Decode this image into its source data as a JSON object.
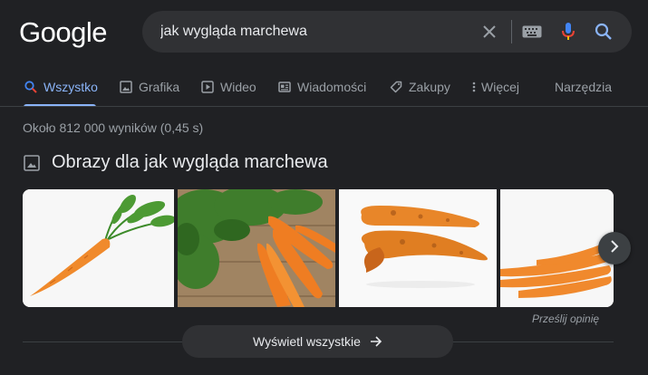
{
  "logo": "Google",
  "search": {
    "query": "jak wygląda marchewa"
  },
  "tabs": [
    {
      "label": "Wszystko",
      "icon": "search-icon",
      "active": true
    },
    {
      "label": "Grafika",
      "icon": "image-icon"
    },
    {
      "label": "Wideo",
      "icon": "video-icon"
    },
    {
      "label": "Wiadomości",
      "icon": "news-icon"
    },
    {
      "label": "Zakupy",
      "icon": "tag-icon"
    },
    {
      "label": "Więcej",
      "icon": "more-vert-icon"
    }
  ],
  "tools_label": "Narzędzia",
  "result_stats": "Około 812 000 wyników (0,45 s)",
  "images_section": {
    "title": "Obrazy dla jak wygląda marchewa",
    "feedback": "Prześlij opinię",
    "view_all": "Wyświetl wszystkie"
  },
  "colors": {
    "background": "#202124",
    "accent": "#8ab4f8",
    "carrot": "#f08a2c"
  }
}
